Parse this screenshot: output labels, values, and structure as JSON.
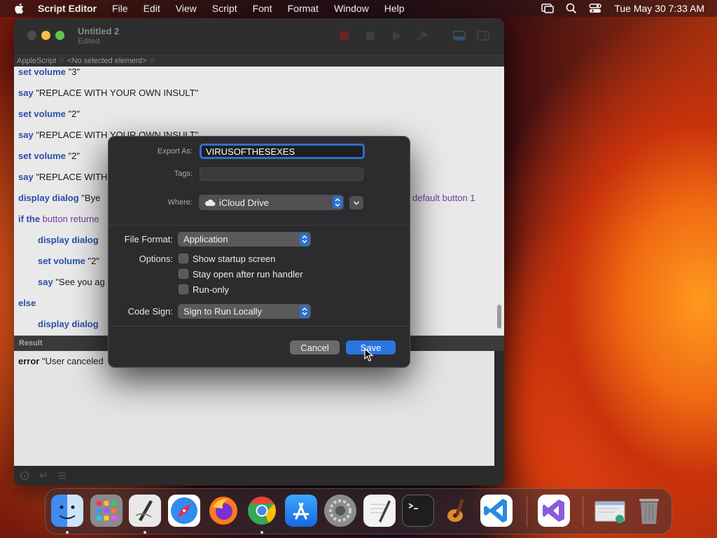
{
  "menubar": {
    "app_name": "Script Editor",
    "menus": [
      "File",
      "Edit",
      "View",
      "Script",
      "Font",
      "Format",
      "Window",
      "Help"
    ],
    "clock": "Tue May 30  7:33 AM"
  },
  "window": {
    "title": "Untitled 2",
    "subtitle": "Edited",
    "navbar": "AppleScript ♢ <No selected element> ♢",
    "code_lines": [
      {
        "kw": "set volume",
        "rest": " \"3\""
      },
      {
        "kw": "say",
        "rest": " \"REPLACE WITH YOUR OWN INSULT\""
      },
      {
        "kw": "set volume",
        "rest": " \"2\""
      },
      {
        "kw": "say",
        "rest": " \"REPLACE WITH YOUR OWN INSULT\""
      },
      {
        "kw": "set volume",
        "rest": " \"2\""
      },
      {
        "kw": "say",
        "rest": " \"REPLACE WITH"
      },
      {
        "kw": "display dialog",
        "rest": " \"Bye"
      },
      {
        "kw": "if the",
        "rest": " button returne"
      },
      {
        "kw": "display dialog",
        "rest": ""
      },
      {
        "kw": "set volume",
        "rest": " \"2\""
      },
      {
        "kw": "say",
        "rest": " \"See you ag"
      },
      {
        "kw": "else",
        "rest": ""
      },
      {
        "kw": "display dialog",
        "rest": ""
      }
    ],
    "code_tail": "default button 1",
    "result_header": "Result",
    "result_kw": "error",
    "result_rest": " \"User canceled"
  },
  "dialog": {
    "export_label": "Export As:",
    "export_value": "VIRUSOFTHESEXES",
    "tags_label": "Tags:",
    "where_label": "Where:",
    "where_value": "iCloud Drive",
    "file_format_label": "File Format:",
    "file_format_value": "Application",
    "options_label": "Options:",
    "options": [
      "Show startup screen",
      "Stay open after run handler",
      "Run-only"
    ],
    "code_sign_label": "Code Sign:",
    "code_sign_value": "Sign to Run Locally",
    "cancel_label": "Cancel",
    "save_label": "Save"
  },
  "dock": {
    "apps": [
      "finder",
      "launchpad",
      "script-editor",
      "safari",
      "firefox",
      "chrome",
      "app-store",
      "system-settings",
      "textedit",
      "terminal",
      "garageband",
      "vscode",
      "visual-studio",
      "preview",
      "trash"
    ]
  },
  "colors": {
    "accent": "#2a75e0",
    "keyword": "#2a4fa8"
  }
}
